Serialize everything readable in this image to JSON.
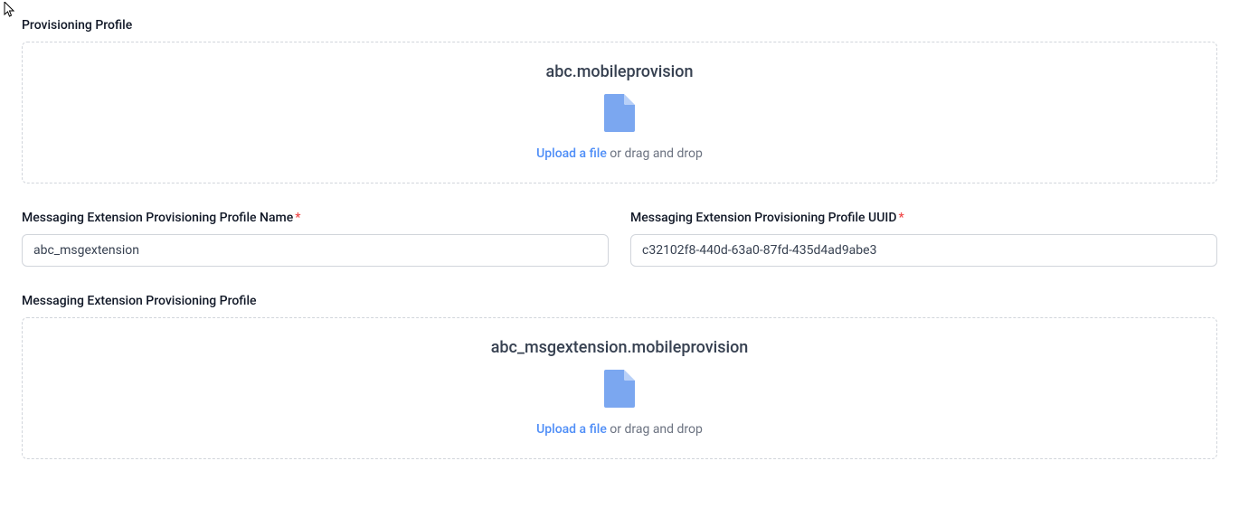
{
  "labels": {
    "provisioning_profile": "Provisioning Profile",
    "msg_ext_profile_name": "Messaging Extension Provisioning Profile Name",
    "msg_ext_profile_uuid": "Messaging Extension Provisioning Profile UUID",
    "msg_ext_profile": "Messaging Extension Provisioning Profile"
  },
  "dropzone1": {
    "filename": "abc.mobileprovision",
    "upload_link": "Upload a file",
    "drag_text": " or drag and drop"
  },
  "dropzone2": {
    "filename": "abc_msgextension.mobileprovision",
    "upload_link": "Upload a file",
    "drag_text": " or drag and drop"
  },
  "inputs": {
    "msg_ext_name": "abc_msgextension",
    "msg_ext_uuid": "c32102f8-440d-63a0-87fd-435d4ad9abe3"
  },
  "colors": {
    "link": "#4f8ef7",
    "icon": "#7ba7f0",
    "border": "#d1d5db"
  }
}
